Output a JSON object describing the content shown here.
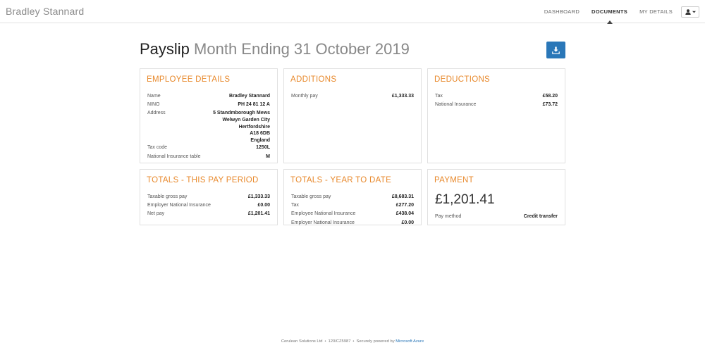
{
  "header": {
    "brand": "Bradley Stannard",
    "nav": [
      {
        "label": "DASHBOARD"
      },
      {
        "label": "DOCUMENTS"
      },
      {
        "label": "MY DETAILS"
      }
    ]
  },
  "page": {
    "title_strong": "Payslip",
    "title_rest": "Month Ending 31 October 2019"
  },
  "employee": {
    "title": "EMPLOYEE DETAILS",
    "name_label": "Name",
    "name": "Bradley Stannard",
    "nino_label": "NINO",
    "nino": "PH 24 81 12 A",
    "address_label": "Address",
    "address": [
      "5 Standmborough Mews",
      "Welwyn Garden City",
      "Hertfordshire",
      "A18 6DB",
      "England"
    ],
    "taxcode_label": "Tax code",
    "taxcode": "1250L",
    "ni_table_label": "National Insurance table",
    "ni_table": "M"
  },
  "additions": {
    "title": "ADDITIONS",
    "rows": [
      {
        "label": "Monthly pay",
        "value": "£1,333.33"
      }
    ]
  },
  "deductions": {
    "title": "DEDUCTIONS",
    "rows": [
      {
        "label": "Tax",
        "value": "£58.20"
      },
      {
        "label": "National Insurance",
        "value": "£73.72"
      }
    ]
  },
  "totals_period": {
    "title": "TOTALS - THIS PAY PERIOD",
    "rows": [
      {
        "label": "Taxable gross pay",
        "value": "£1,333.33"
      },
      {
        "label": "Employer National Insurance",
        "value": "£0.00"
      },
      {
        "label": "Net pay",
        "value": "£1,201.41"
      }
    ]
  },
  "totals_ytd": {
    "title": "TOTALS - YEAR TO DATE",
    "rows": [
      {
        "label": "Taxable gross pay",
        "value": "£8,683.31"
      },
      {
        "label": "Tax",
        "value": "£277.20"
      },
      {
        "label": "Employee National Insurance",
        "value": "£438.04"
      },
      {
        "label": "Employer National Insurance",
        "value": "£0.00"
      }
    ]
  },
  "payment": {
    "title": "PAYMENT",
    "amount": "£1,201.41",
    "method_label": "Pay method",
    "method": "Credit transfer"
  },
  "footer": {
    "company": "Cerulean Solutions Ltd",
    "code": "120/CZ5987",
    "powered_prefix": "Securely powered by",
    "powered_link": "Microsoft Azure"
  },
  "colors": {
    "accent": "#e8892c",
    "primary": "#2a77b8"
  },
  "icons": {
    "user": "user-icon",
    "download": "download-icon",
    "caret": "caret-down-icon"
  }
}
